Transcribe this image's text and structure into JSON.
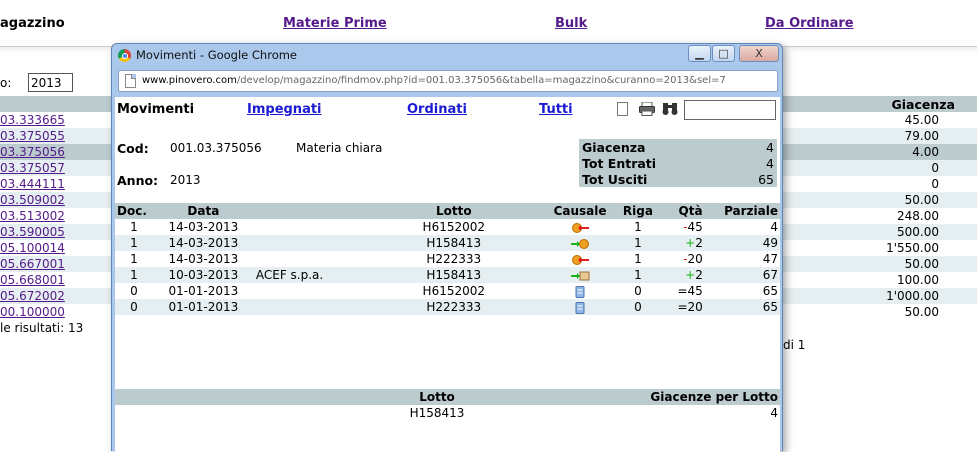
{
  "background": {
    "title_left": "agazzino",
    "nav_links": [
      "Materie Prime",
      "Bulk",
      "Da Ordinare"
    ],
    "year_label": "o:",
    "year_value": "2013",
    "giacenza_header": "Giacenza",
    "rows": [
      {
        "code": "03.333665",
        "giacenza": "45.00"
      },
      {
        "code": "03.375055",
        "giacenza": "79.00"
      },
      {
        "code": "03.375056",
        "giacenza": "4.00"
      },
      {
        "code": "03.375057",
        "giacenza": "0"
      },
      {
        "code": "03.444111",
        "giacenza": "0"
      },
      {
        "code": "03.509002",
        "giacenza": "50.00"
      },
      {
        "code": "03.513002",
        "giacenza": "248.00"
      },
      {
        "code": "03.590005",
        "giacenza": "500.00"
      },
      {
        "code": "05.100014",
        "giacenza": "1'550.00"
      },
      {
        "code": "05.667001",
        "giacenza": "50.00"
      },
      {
        "code": "05.668001",
        "giacenza": "100.00"
      },
      {
        "code": "05.672002",
        "giacenza": "1'000.00"
      },
      {
        "code": "00.100000",
        "giacenza": "50.00"
      }
    ],
    "result_count": "le risultati: 13",
    "page_info": "di 1"
  },
  "window": {
    "title": "Movimenti - Google Chrome",
    "url_host": "www.pinovero.com",
    "url_path": "/develop/magazzino/findmov.php?id=001.03.375056&tabella=magazzino&curanno=2013&sel=7",
    "btn_min": "▁",
    "btn_max": "□",
    "btn_close": "X"
  },
  "content": {
    "heading": "Movimenti",
    "tabs": [
      "Impegnati",
      "Ordinati",
      "Tutti"
    ],
    "search_value": "",
    "cod_label": "Cod:",
    "cod_value": "001.03.375056",
    "description": "Materia chiara",
    "anno_label": "Anno:",
    "anno_value": "2013",
    "summary": [
      {
        "label": "Giacenza",
        "value": "4"
      },
      {
        "label": "Tot Entrati",
        "value": "4"
      },
      {
        "label": "Tot Usciti",
        "value": "65"
      }
    ],
    "movements_headers": [
      "Doc.",
      "Data",
      "Lotto",
      "Causale",
      "Riga",
      "Qtà",
      "Parziale"
    ],
    "movements": [
      {
        "doc": "1",
        "data": "14-03-2013",
        "cliente": "",
        "lotto": "H6152002",
        "causale_icon": "outgoing-shipment-icon",
        "riga": "1",
        "sign": "-",
        "qta": "45",
        "parziale": "4"
      },
      {
        "doc": "1",
        "data": "14-03-2013",
        "cliente": "",
        "lotto": "H158413",
        "causale_icon": "incoming-shipment-icon",
        "riga": "1",
        "sign": "+",
        "qta": "2",
        "parziale": "49"
      },
      {
        "doc": "1",
        "data": "14-03-2013",
        "cliente": "",
        "lotto": "H222333",
        "causale_icon": "outgoing-shipment-icon",
        "riga": "1",
        "sign": "-",
        "qta": "20",
        "parziale": "47"
      },
      {
        "doc": "1",
        "data": "10-03-2013",
        "cliente": "ACEF s.p.a.",
        "lotto": "H158413",
        "causale_icon": "incoming-box-icon",
        "riga": "1",
        "sign": "+",
        "qta": "2",
        "parziale": "67"
      },
      {
        "doc": "0",
        "data": "01-01-2013",
        "cliente": "",
        "lotto": "H6152002",
        "causale_icon": "inventory-icon",
        "riga": "0",
        "sign": "=",
        "qta": "45",
        "parziale": "65"
      },
      {
        "doc": "0",
        "data": "01-01-2013",
        "cliente": "",
        "lotto": "H222333",
        "causale_icon": "inventory-icon",
        "riga": "0",
        "sign": "=",
        "qta": "20",
        "parziale": "65"
      }
    ],
    "lot_headers": [
      "Lotto",
      "Giacenze per Lotto"
    ],
    "lots": [
      {
        "lotto": "H158413",
        "giacenza": "4"
      }
    ]
  },
  "colors": {
    "header_bg": "#bccbcd",
    "stripe_bg": "#e5eef0",
    "link_purple": "#551a8b",
    "link_blue": "#1a1ad0",
    "window_frame": "#a9c8ec",
    "minus": "#e01b1b",
    "plus": "#19b319"
  }
}
